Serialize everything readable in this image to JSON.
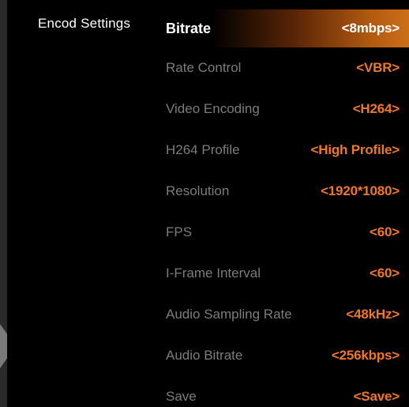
{
  "category": {
    "label": "Encod Settings"
  },
  "settings": [
    {
      "label": "Bitrate",
      "value": "<8mbps>",
      "selected": true
    },
    {
      "label": "Rate Control",
      "value": "<VBR>"
    },
    {
      "label": "Video Encoding",
      "value": "<H264>"
    },
    {
      "label": "H264 Profile",
      "value": "<High Profile>"
    },
    {
      "label": "Resolution",
      "value": "<1920*1080>"
    },
    {
      "label": "FPS",
      "value": "<60>"
    },
    {
      "label": "I-Frame Interval",
      "value": "<60>"
    },
    {
      "label": "Audio Sampling Rate",
      "value": "<48kHz>"
    },
    {
      "label": "Audio Bitrate",
      "value": "<256kbps>"
    },
    {
      "label": "Save",
      "value": "<Save>"
    }
  ],
  "colors": {
    "background": "#000000",
    "selected_gradient_end": "#cc6f18",
    "value_orange": "#f0772a",
    "label_grey": "#7c7c7c"
  },
  "icons": {
    "left_arrow": "triangle-left-arrow-icon"
  }
}
